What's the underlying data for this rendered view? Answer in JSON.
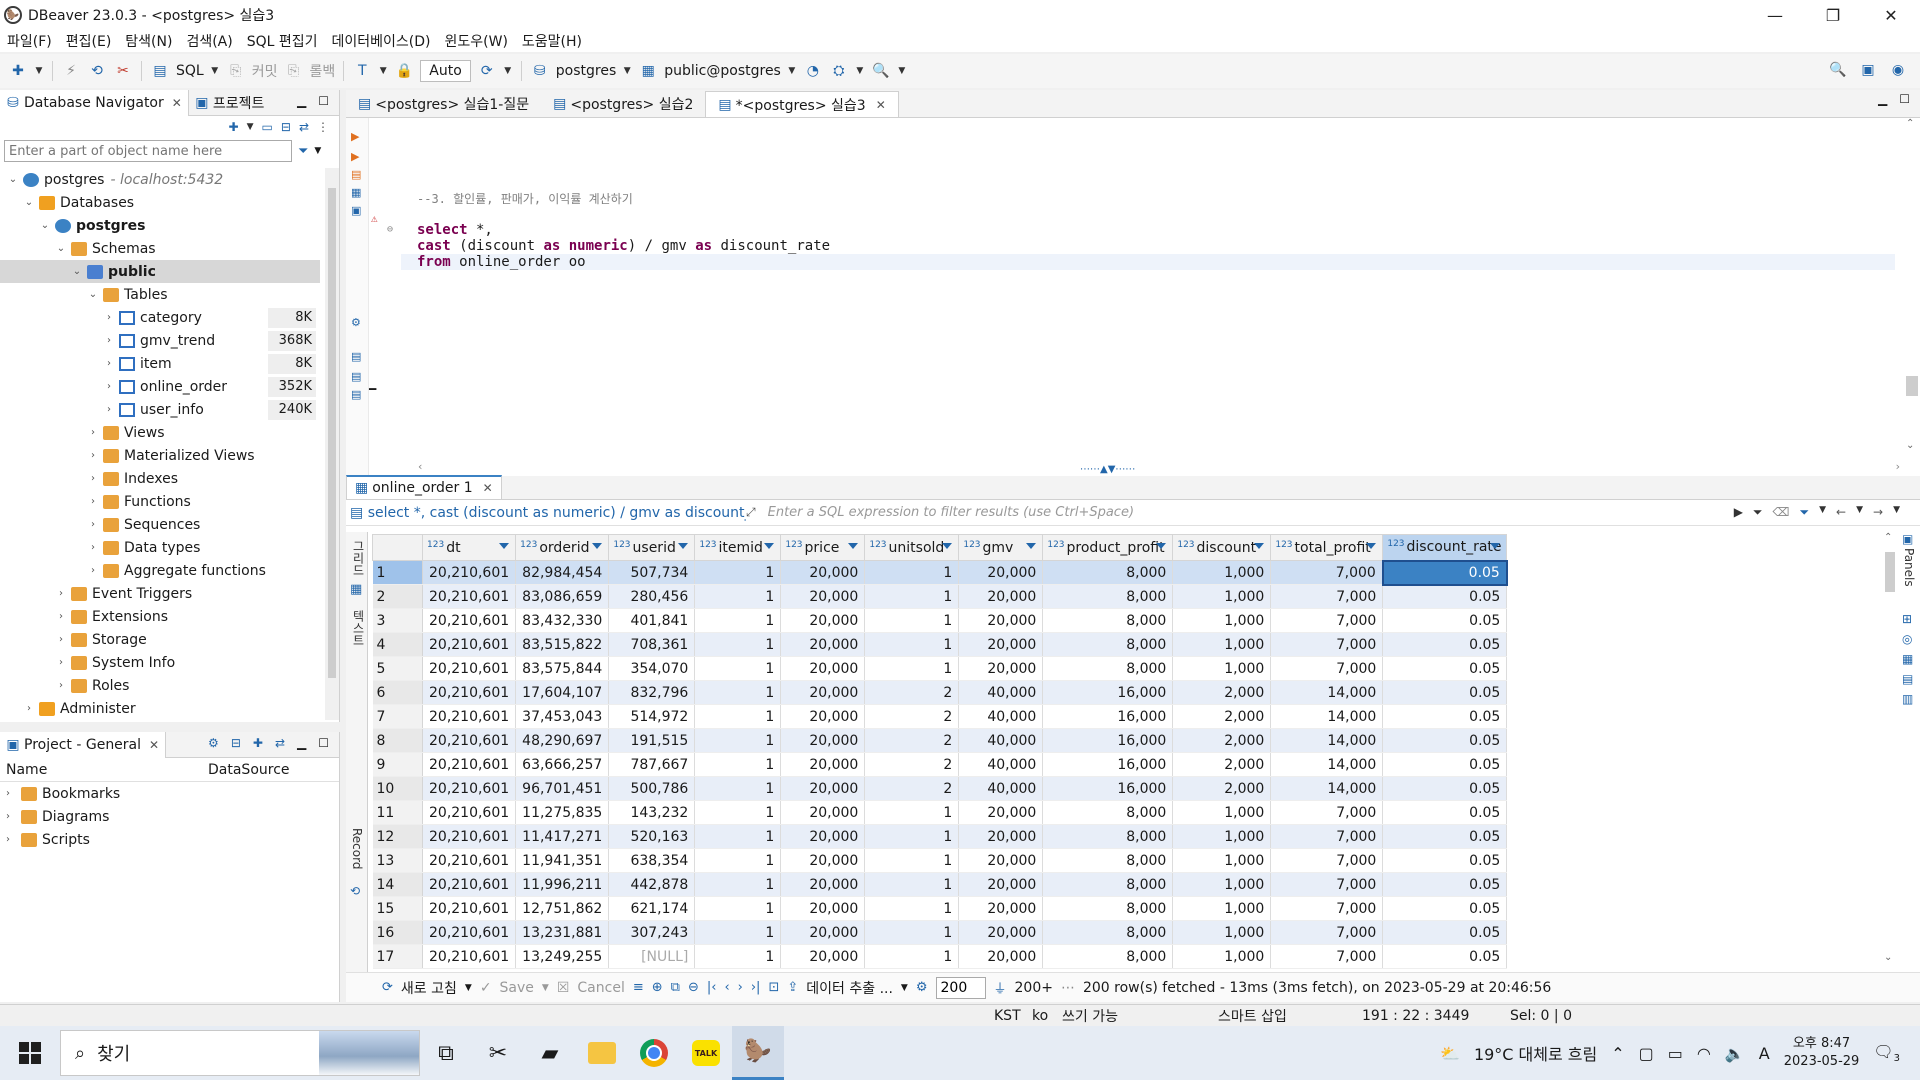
{
  "window": {
    "title": "DBeaver 23.0.3 - <postgres> 실습3",
    "controls": [
      "—",
      "❐",
      "✕"
    ]
  },
  "menu": [
    "파일(F)",
    "편집(E)",
    "탐색(N)",
    "검색(A)",
    "SQL 편집기",
    "데이터베이스(D)",
    "윈도우(W)",
    "도움말(H)"
  ],
  "toolbar": {
    "sql_label": "SQL",
    "commit_label": "커밋",
    "rollback_label": "롤백",
    "transaction_mode": "Auto",
    "datasource": "postgres",
    "schema": "public@postgres"
  },
  "navigator": {
    "tab_label": "Database Navigator",
    "tab2_label": "프로젝트",
    "filter_placeholder": "Enter a part of object name here",
    "tree": [
      {
        "level": 0,
        "label": "postgres",
        "host": "- localhost:5432",
        "icon": "pg",
        "exp": "⌄"
      },
      {
        "level": 1,
        "label": "Databases",
        "icon": "db",
        "exp": "⌄"
      },
      {
        "level": 2,
        "label": "postgres",
        "icon": "pg",
        "exp": "⌄",
        "bold": true
      },
      {
        "level": 3,
        "label": "Schemas",
        "icon": "folder",
        "exp": "⌄"
      },
      {
        "level": 4,
        "label": "public",
        "icon": "schema",
        "exp": "⌄",
        "bold": true,
        "selected": true
      },
      {
        "level": 5,
        "label": "Tables",
        "icon": "folder",
        "exp": "⌄"
      },
      {
        "level": 6,
        "label": "category",
        "icon": "table",
        "exp": "›",
        "size": "8K"
      },
      {
        "level": 6,
        "label": "gmv_trend",
        "icon": "table",
        "exp": "›",
        "size": "368K"
      },
      {
        "level": 6,
        "label": "item",
        "icon": "table",
        "exp": "›",
        "size": "8K"
      },
      {
        "level": 6,
        "label": "online_order",
        "icon": "table",
        "exp": "›",
        "size": "352K"
      },
      {
        "level": 6,
        "label": "user_info",
        "icon": "table",
        "exp": "›",
        "size": "240K"
      },
      {
        "level": 5,
        "label": "Views",
        "icon": "folder",
        "exp": "›"
      },
      {
        "level": 5,
        "label": "Materialized Views",
        "icon": "folder",
        "exp": "›"
      },
      {
        "level": 5,
        "label": "Indexes",
        "icon": "folder",
        "exp": "›"
      },
      {
        "level": 5,
        "label": "Functions",
        "icon": "folder",
        "exp": "›"
      },
      {
        "level": 5,
        "label": "Sequences",
        "icon": "folder",
        "exp": "›"
      },
      {
        "level": 5,
        "label": "Data types",
        "icon": "folder",
        "exp": "›"
      },
      {
        "level": 5,
        "label": "Aggregate functions",
        "icon": "folder",
        "exp": "›"
      },
      {
        "level": 3,
        "label": "Event Triggers",
        "icon": "folder",
        "exp": "›"
      },
      {
        "level": 3,
        "label": "Extensions",
        "icon": "folder",
        "exp": "›"
      },
      {
        "level": 3,
        "label": "Storage",
        "icon": "folder",
        "exp": "›"
      },
      {
        "level": 3,
        "label": "System Info",
        "icon": "folder",
        "exp": "›"
      },
      {
        "level": 3,
        "label": "Roles",
        "icon": "folder",
        "exp": "›"
      },
      {
        "level": 1,
        "label": "Administer",
        "icon": "db",
        "exp": "›"
      }
    ]
  },
  "project": {
    "tab_label": "Project - General",
    "col_name": "Name",
    "col_datasource": "DataSource",
    "items": [
      "Bookmarks",
      "Diagrams",
      "Scripts"
    ]
  },
  "editor": {
    "tabs": [
      {
        "label": "<postgres> 실습1-질문",
        "active": false
      },
      {
        "label": "<postgres> 실습2",
        "active": false
      },
      {
        "label": "*<postgres> 실습3",
        "active": true
      }
    ],
    "comment": "--3. 할인률, 판매가, 이익률 계산하기",
    "line1_kw": "select",
    "line1_rest": " *,",
    "line2_kw1": "cast",
    "line2_mid1": " (discount ",
    "line2_kw2": "as",
    "line2_sp": " ",
    "line2_kw3": "numeric",
    "line2_mid2": ") / gmv ",
    "line2_kw4": "as",
    "line2_rest": " discount_rate",
    "line3_kw": "from",
    "line3_rest": " online_order oo"
  },
  "results": {
    "tab_label": "online_order 1",
    "filter_sql": "select *, cast (discount as numeric) / gmv as discount_",
    "filter_placeholder": "Enter a SQL expression to filter results (use Ctrl+Space)",
    "side_label_grid": "그리드",
    "side_label_text": "텍스트",
    "side_label_record": "Record",
    "panels_label": "Panels",
    "null_text": "[NULL]",
    "columns": [
      "dt",
      "orderid",
      "userid",
      "itemid",
      "price",
      "unitsold",
      "gmv",
      "product_profit",
      "discount",
      "total_profit",
      "discount_rate"
    ],
    "column_type": "123",
    "rows": [
      [
        "20,210,601",
        "82,984,454",
        "507,734",
        "1",
        "20,000",
        "1",
        "20,000",
        "8,000",
        "1,000",
        "7,000",
        "0.05"
      ],
      [
        "20,210,601",
        "83,086,659",
        "280,456",
        "1",
        "20,000",
        "1",
        "20,000",
        "8,000",
        "1,000",
        "7,000",
        "0.05"
      ],
      [
        "20,210,601",
        "83,432,330",
        "401,841",
        "1",
        "20,000",
        "1",
        "20,000",
        "8,000",
        "1,000",
        "7,000",
        "0.05"
      ],
      [
        "20,210,601",
        "83,515,822",
        "708,361",
        "1",
        "20,000",
        "1",
        "20,000",
        "8,000",
        "1,000",
        "7,000",
        "0.05"
      ],
      [
        "20,210,601",
        "83,575,844",
        "354,070",
        "1",
        "20,000",
        "1",
        "20,000",
        "8,000",
        "1,000",
        "7,000",
        "0.05"
      ],
      [
        "20,210,601",
        "17,604,107",
        "832,796",
        "1",
        "20,000",
        "2",
        "40,000",
        "16,000",
        "2,000",
        "14,000",
        "0.05"
      ],
      [
        "20,210,601",
        "37,453,043",
        "514,972",
        "1",
        "20,000",
        "2",
        "40,000",
        "16,000",
        "2,000",
        "14,000",
        "0.05"
      ],
      [
        "20,210,601",
        "48,290,697",
        "191,515",
        "1",
        "20,000",
        "2",
        "40,000",
        "16,000",
        "2,000",
        "14,000",
        "0.05"
      ],
      [
        "20,210,601",
        "63,666,257",
        "787,667",
        "1",
        "20,000",
        "2",
        "40,000",
        "16,000",
        "2,000",
        "14,000",
        "0.05"
      ],
      [
        "20,210,601",
        "96,701,451",
        "500,786",
        "1",
        "20,000",
        "2",
        "40,000",
        "16,000",
        "2,000",
        "14,000",
        "0.05"
      ],
      [
        "20,210,601",
        "11,275,835",
        "143,232",
        "1",
        "20,000",
        "1",
        "20,000",
        "8,000",
        "1,000",
        "7,000",
        "0.05"
      ],
      [
        "20,210,601",
        "11,417,271",
        "520,163",
        "1",
        "20,000",
        "1",
        "20,000",
        "8,000",
        "1,000",
        "7,000",
        "0.05"
      ],
      [
        "20,210,601",
        "11,941,351",
        "638,354",
        "1",
        "20,000",
        "1",
        "20,000",
        "8,000",
        "1,000",
        "7,000",
        "0.05"
      ],
      [
        "20,210,601",
        "11,996,211",
        "442,878",
        "1",
        "20,000",
        "1",
        "20,000",
        "8,000",
        "1,000",
        "7,000",
        "0.05"
      ],
      [
        "20,210,601",
        "12,751,862",
        "621,174",
        "1",
        "20,000",
        "1",
        "20,000",
        "8,000",
        "1,000",
        "7,000",
        "0.05"
      ],
      [
        "20,210,601",
        "13,231,881",
        "307,243",
        "1",
        "20,000",
        "1",
        "20,000",
        "8,000",
        "1,000",
        "7,000",
        "0.05"
      ],
      [
        "20,210,601",
        "13,249,255",
        "[NULL]",
        "1",
        "20,000",
        "1",
        "20,000",
        "8,000",
        "1,000",
        "7,000",
        "0.05"
      ]
    ],
    "toolbar": {
      "refresh": "새로 고침",
      "save": "Save",
      "cancel": "Cancel",
      "export": "데이터 추출 ...",
      "limit": "200",
      "count": "200+",
      "status": "200 row(s) fetched - 13ms (3ms fetch), on 2023-05-29 at 20:46:56"
    }
  },
  "statusbar": {
    "tz": "KST",
    "locale": "ko",
    "writable": "쓰기 가능",
    "insert_mode": "스마트 삽입",
    "position": "191 : 22 : 3449",
    "selection": "Sel: 0 | 0"
  },
  "taskbar": {
    "search_label": "찾기",
    "weather": "19°C  대체로 흐림",
    "ime": "A",
    "time": "오후 8:47",
    "date": "2023-05-29",
    "notif_count": "3"
  }
}
